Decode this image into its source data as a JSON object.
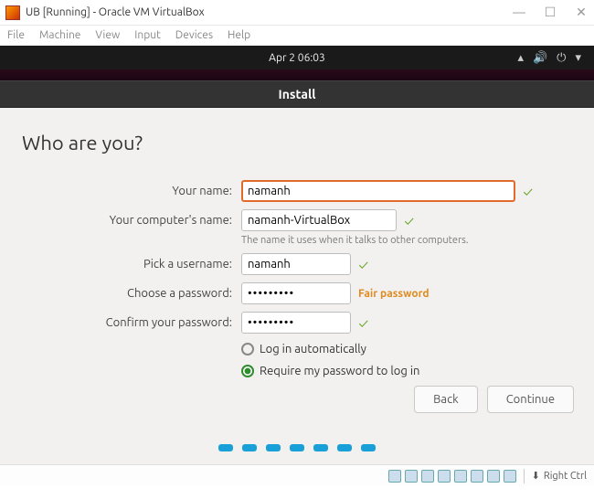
{
  "window": {
    "title": "UB [Running] - Oracle VM VirtualBox",
    "menu": [
      "File",
      "Machine",
      "View",
      "Input",
      "Devices",
      "Help"
    ],
    "controls": {
      "min": "—",
      "max": "☐",
      "close": "✕"
    }
  },
  "gnome": {
    "datetime": "Apr 2  06:03",
    "tray": {
      "net": "▴",
      "vol": "🔊",
      "power": "⏻",
      "caret": "▾"
    }
  },
  "installer": {
    "header": "Install",
    "heading": "Who are you?",
    "labels": {
      "name": "Your name:",
      "computer": "Your computer's name:",
      "computer_hint": "The name it uses when it talks to other computers.",
      "username": "Pick a username:",
      "password": "Choose a password:",
      "confirm": "Confirm your password:"
    },
    "values": {
      "name": "namanh",
      "computer": "namanh-VirtualBox",
      "username": "namanh",
      "password": "•••••••••",
      "confirm": "•••••••••",
      "password_strength": "Fair password"
    },
    "radios": {
      "auto": "Log in automatically",
      "require": "Require my password to log in",
      "selected": "require"
    },
    "buttons": {
      "back": "Back",
      "continue": "Continue"
    }
  },
  "statusbar": {
    "hostkey_icon": "⬇",
    "hostkey_label": "Right Ctrl"
  }
}
